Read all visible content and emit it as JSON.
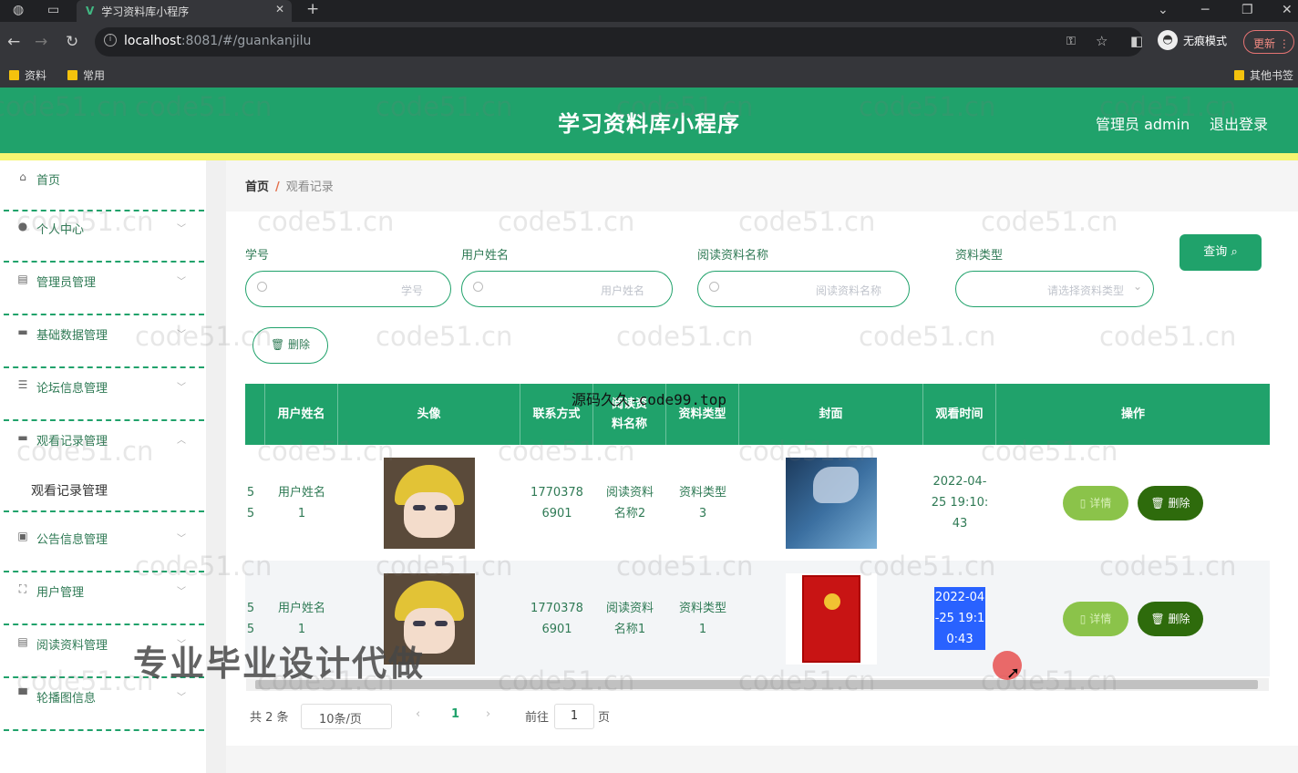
{
  "browser": {
    "tab_title": "学习资料库小程序",
    "url_host": "localhost",
    "url_rest": ":8081/#/guankanjilu",
    "incognito": "无痕模式",
    "update": "更新",
    "bookmarks": [
      "资料",
      "常用"
    ],
    "bookmarks_other": "其他书签"
  },
  "header": {
    "title": "学习资料库小程序",
    "admin": "管理员 admin",
    "logout": "退出登录"
  },
  "sidebar": {
    "items": [
      {
        "label": "首页",
        "icon": "home-icon"
      },
      {
        "label": "个人中心",
        "icon": "user-icon"
      },
      {
        "label": "管理员管理",
        "icon": "chart-icon"
      },
      {
        "label": "基础数据管理",
        "icon": "message-icon"
      },
      {
        "label": "论坛信息管理",
        "icon": "sliders-icon"
      },
      {
        "label": "观看记录管理",
        "icon": "briefcase-icon"
      },
      {
        "label": "公告信息管理",
        "icon": "clipboard-icon"
      },
      {
        "label": "用户管理",
        "icon": "fullscreen-icon"
      },
      {
        "label": "阅读资料管理",
        "icon": "document-icon"
      },
      {
        "label": "轮播图信息",
        "icon": "monitor-icon"
      }
    ],
    "submenu": "观看记录管理"
  },
  "breadcrumb": {
    "home": "首页",
    "sep": "/",
    "current": "观看记录"
  },
  "filters": {
    "f1_label": "学号",
    "f1_placeholder": "学号",
    "f2_label": "用户姓名",
    "f2_placeholder": "用户姓名",
    "f3_label": "阅读资料名称",
    "f3_placeholder": "阅读资料名称",
    "f4_label": "资料类型",
    "f4_placeholder": "请选择资料类型",
    "query": "查询"
  },
  "actions": {
    "delete": "删除"
  },
  "table": {
    "headers": [
      "用户姓名",
      "头像",
      "联系方式",
      "阅读资料名称",
      "资料类型",
      "封面",
      "观看时间",
      "操作"
    ],
    "rows": [
      {
        "col0a": "5",
        "col0b": "5",
        "name": "用户姓名1",
        "phone": "17703786901",
        "material": "阅读资料名称2",
        "type": "资料类型3",
        "time": "2022-04-25 19:10:43",
        "detail": "详情",
        "delete": "删除"
      },
      {
        "col0a": "5",
        "col0b": "5",
        "name": "用户姓名1",
        "phone": "17703786901",
        "material": "阅读资料名称1",
        "type": "资料类型1",
        "time": "2022-04-25 19:10:43",
        "detail": "详情",
        "delete": "删除"
      }
    ]
  },
  "pager": {
    "total": "共 2 条",
    "size": "10条/页",
    "page": "1",
    "goto": "前往",
    "page_input": "1",
    "page_unit": "页"
  },
  "overlays": {
    "top": "源码久久-code99.top",
    "bottom": "专业毕业设计代做",
    "watermark": "code51.cn"
  }
}
